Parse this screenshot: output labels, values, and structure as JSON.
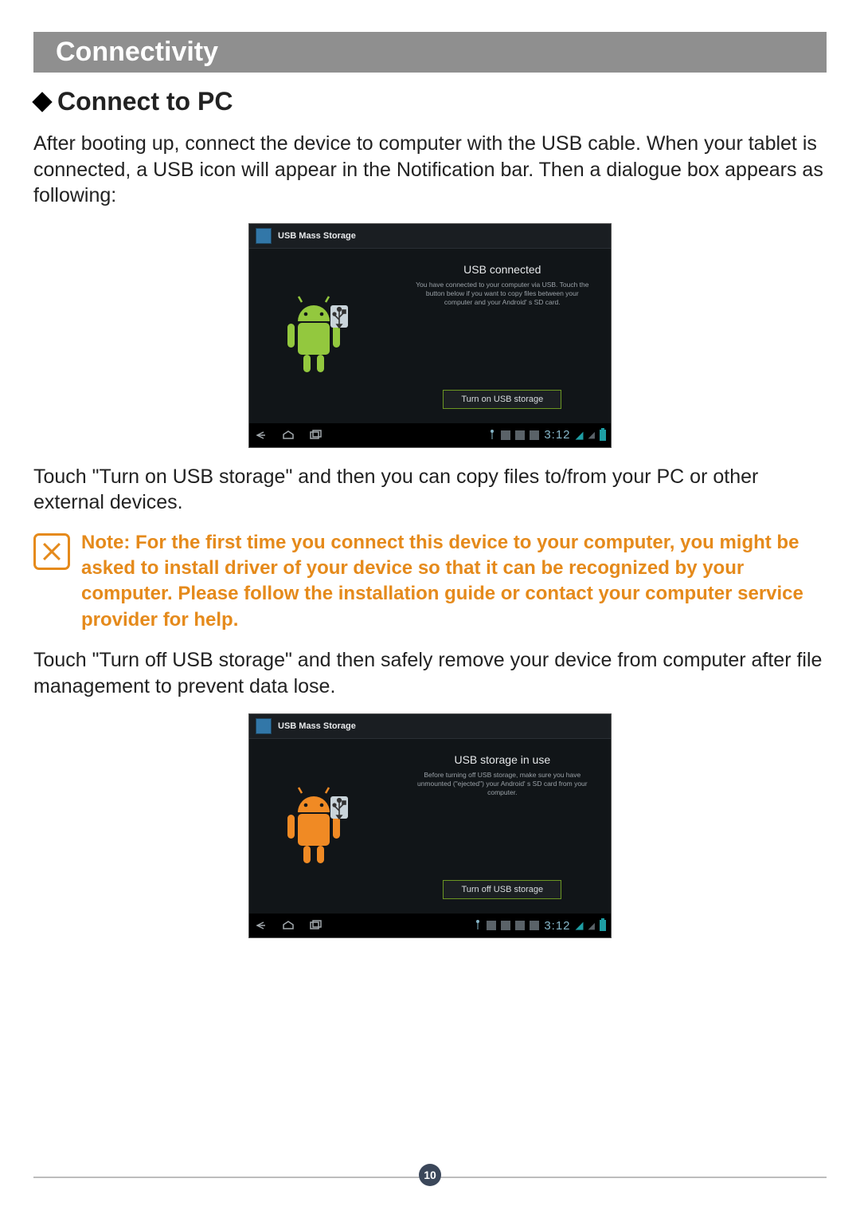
{
  "section_title": "Connectivity",
  "subheading": "Connect to PC",
  "para1": "After booting up, connect the device to computer with the USB cable. When your tablet is connected, a USB icon will appear in the Notification bar. Then a dialogue box appears as following:",
  "para2": "Touch \"Turn on USB storage\" and then you can copy files to/from your PC or other external devices.",
  "note_text": "Note: For the first time you connect this device to your computer, you might be asked to install driver of your device so that it can be recognized by your computer. Please follow the installation guide or contact your computer service provider for help.",
  "para3": "Touch \"Turn off USB storage\" and then safely remove your device from computer after file management to prevent data lose.",
  "page_number": "10",
  "screenshot1": {
    "titlebar": "USB Mass Storage",
    "heading": "USB connected",
    "body": "You have connected to your computer via USB. Touch the button below if you want to copy files between your computer and your Android' s SD card.",
    "button": "Turn on USB storage",
    "clock": "3:12",
    "robot_color": "#93c83e"
  },
  "screenshot2": {
    "titlebar": "USB Mass Storage",
    "heading": "USB storage in use",
    "body": "Before turning off USB storage, make sure you have unmounted (\"ejected\") your Android' s SD card from your computer.",
    "button": "Turn off USB storage",
    "clock": "3:12",
    "robot_color": "#f08a24"
  }
}
